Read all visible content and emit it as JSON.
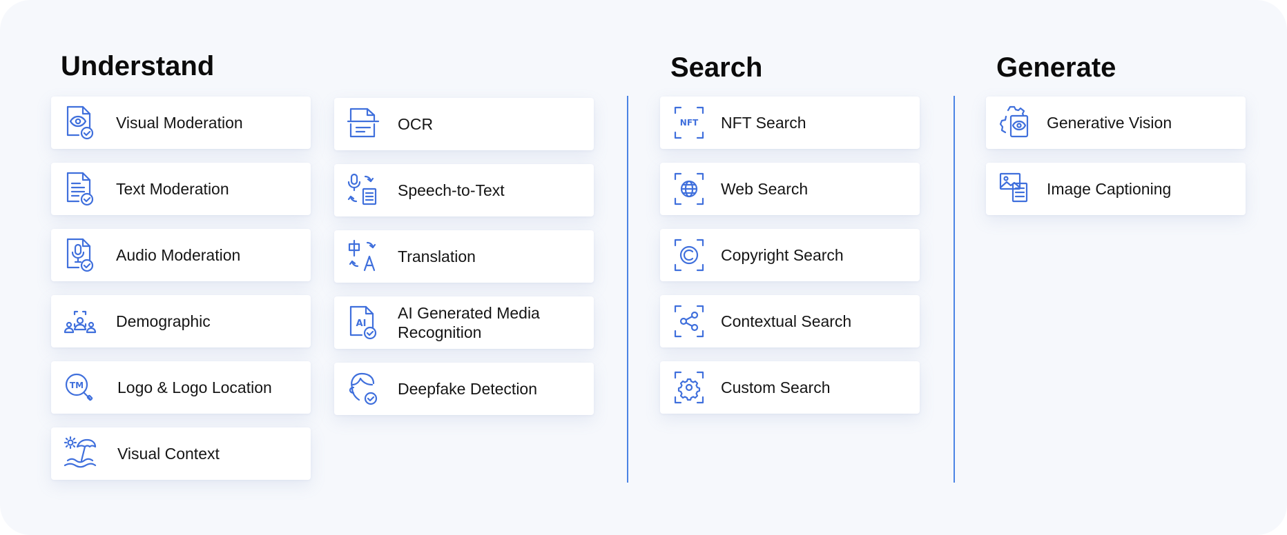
{
  "sections": {
    "understand": {
      "title": "Understand"
    },
    "search": {
      "title": "Search"
    },
    "generate": {
      "title": "Generate"
    }
  },
  "understand_col1": [
    {
      "label": "Visual Moderation",
      "icon": "visual-moderation-icon"
    },
    {
      "label": "Text Moderation",
      "icon": "text-moderation-icon"
    },
    {
      "label": "Audio Moderation",
      "icon": "audio-moderation-icon"
    },
    {
      "label": "Demographic",
      "icon": "demographic-icon"
    },
    {
      "label": "Logo & Logo Location",
      "icon": "logo-location-icon"
    },
    {
      "label": "Visual Context",
      "icon": "visual-context-icon"
    }
  ],
  "understand_col2": [
    {
      "label": "OCR",
      "icon": "ocr-icon"
    },
    {
      "label": "Speech-to-Text",
      "icon": "speech-to-text-icon"
    },
    {
      "label": "Translation",
      "icon": "translation-icon"
    },
    {
      "label": "AI Generated Media Recognition",
      "icon": "ai-generated-media-icon"
    },
    {
      "label": "Deepfake Detection",
      "icon": "deepfake-detection-icon"
    }
  ],
  "search_items": [
    {
      "label": "NFT Search",
      "icon": "nft-search-icon",
      "icon_text": "NFT"
    },
    {
      "label": "Web Search",
      "icon": "web-search-icon"
    },
    {
      "label": "Copyright Search",
      "icon": "copyright-search-icon"
    },
    {
      "label": "Contextual Search",
      "icon": "contextual-search-icon"
    },
    {
      "label": "Custom Search",
      "icon": "custom-search-icon"
    }
  ],
  "generate_items": [
    {
      "label": "Generative Vision",
      "icon": "generative-vision-icon"
    },
    {
      "label": "Image Captioning",
      "icon": "image-captioning-icon"
    }
  ],
  "icon_glyphs": {
    "logo_location": "TM",
    "ai_generated": "AI"
  },
  "colors": {
    "accent": "#3f6fdc",
    "divider": "#4a83e4",
    "panel": "#f6f8fc",
    "card": "#ffffff",
    "text": "#151515"
  }
}
